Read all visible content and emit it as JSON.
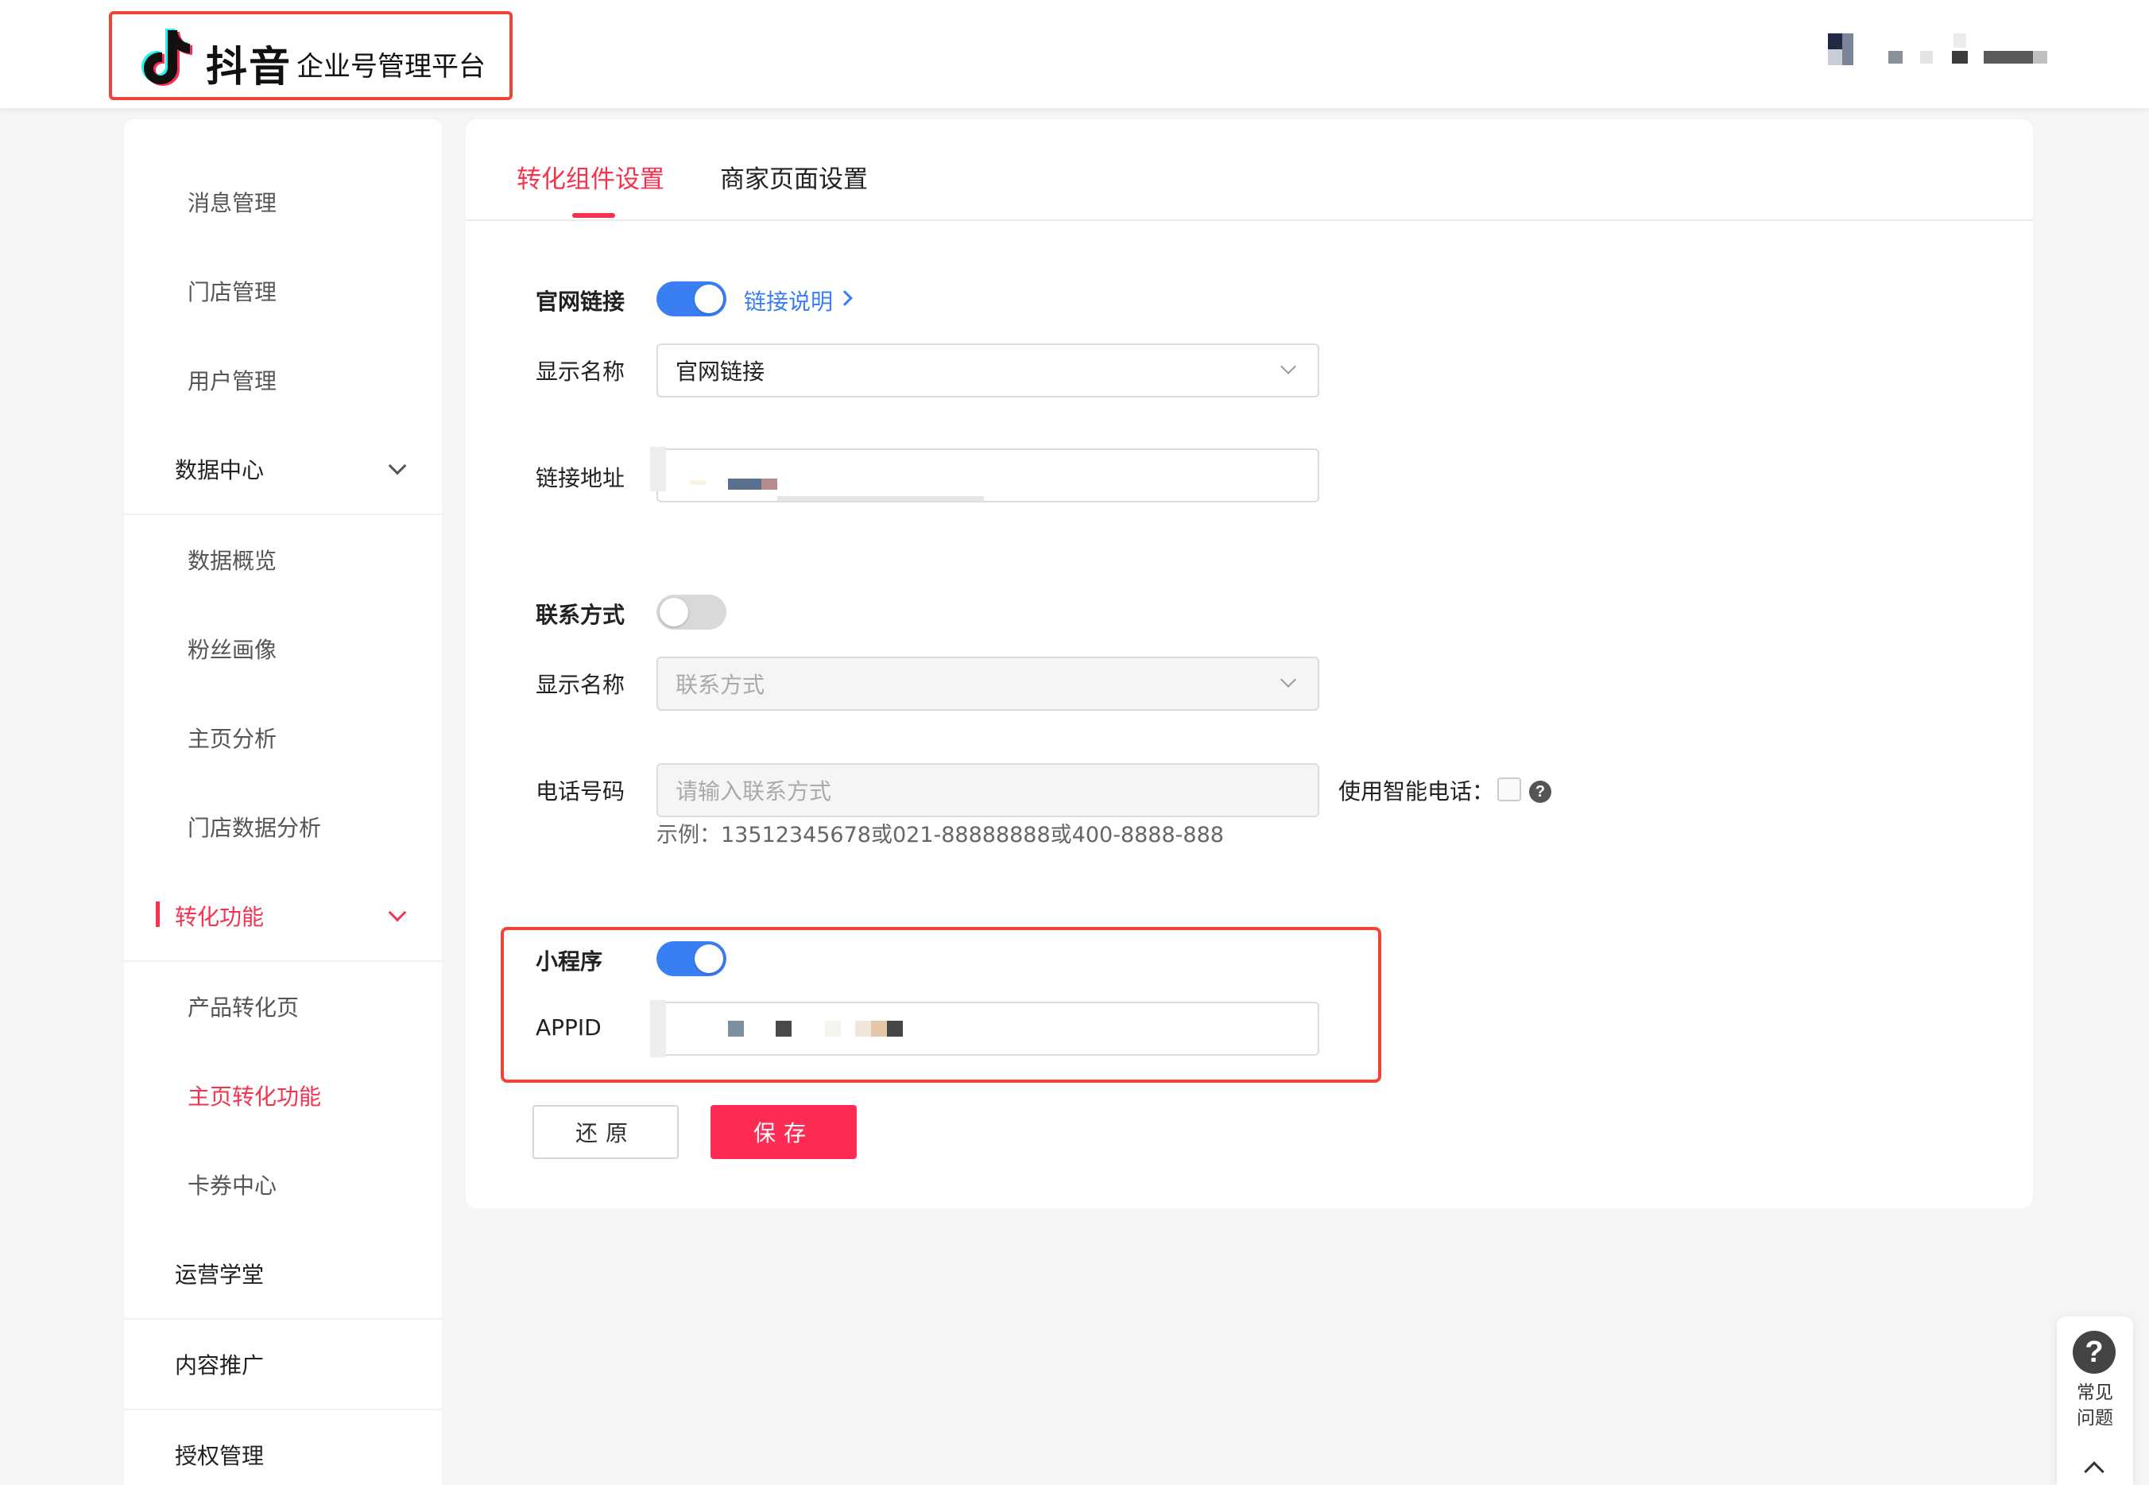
{
  "header": {
    "brand": "抖音",
    "subtitle": "企业号管理平台"
  },
  "sidebar": {
    "items": [
      {
        "label": "消息管理"
      },
      {
        "label": "门店管理"
      },
      {
        "label": "用户管理"
      },
      {
        "label": "数据中心"
      },
      {
        "label": "数据概览"
      },
      {
        "label": "粉丝画像"
      },
      {
        "label": "主页分析"
      },
      {
        "label": "门店数据分析"
      },
      {
        "label": "转化功能"
      },
      {
        "label": "产品转化页"
      },
      {
        "label": "主页转化功能"
      },
      {
        "label": "卡券中心"
      },
      {
        "label": "运营学堂"
      },
      {
        "label": "内容推广"
      },
      {
        "label": "授权管理"
      }
    ]
  },
  "tabs": [
    {
      "label": "转化组件设置"
    },
    {
      "label": "商家页面设置"
    }
  ],
  "website": {
    "title": "官网链接",
    "link_help": "链接说明",
    "name_label": "显示名称",
    "name_value": "官网链接",
    "url_label": "链接地址"
  },
  "contact": {
    "title": "联系方式",
    "name_label": "显示名称",
    "name_value": "联系方式",
    "phone_label": "电话号码",
    "phone_placeholder": "请输入联系方式",
    "smart_phone_label": "使用智能电话：",
    "hint": "示例：13512345678或021-88888888或400-8888-888"
  },
  "miniapp": {
    "title": "小程序",
    "appid_label": "APPID"
  },
  "buttons": {
    "reset": "还原",
    "save": "保存"
  },
  "help": {
    "icon_glyph": "?",
    "line1": "常见",
    "line2": "问题"
  },
  "colors": {
    "accent": "#f5334f",
    "toggle_on": "#3a7ef4",
    "highlight": "#f04436"
  }
}
